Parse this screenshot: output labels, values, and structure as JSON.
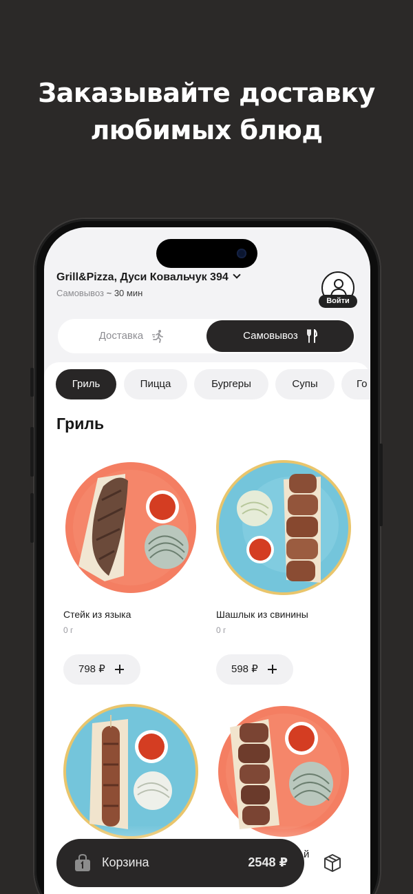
{
  "promo": {
    "headline_line1": "Заказывайте доставку",
    "headline_line2": "любимых блюд"
  },
  "header": {
    "store_name": "Grill&Pizza, Дуси Ковальчук 394",
    "mode_text": "Самовывоз",
    "time_text": "~ 30 мин",
    "login_label": "Войти"
  },
  "mode_toggle": {
    "delivery": "Доставка",
    "pickup": "Самовывоз",
    "selected": "pickup"
  },
  "categories": [
    "Гриль",
    "Пицца",
    "Бургеры",
    "Супы",
    "Го"
  ],
  "section": {
    "title": "Гриль"
  },
  "products": [
    {
      "name": "Стейк из языка",
      "weight": "0 г",
      "price": "798 ₽"
    },
    {
      "name": "Шашлык из свинины",
      "weight": "0 г",
      "price": "598 ₽"
    },
    {
      "name": "",
      "weight": "",
      "price": ""
    },
    {
      "name": "",
      "weight": "",
      "price": ""
    }
  ],
  "cart": {
    "label": "Корзина",
    "total": "2548 ₽",
    "peek_text": "й"
  },
  "colors": {
    "background": "#2b2928",
    "dark": "#282626",
    "chip": "#f1f1f3"
  },
  "icons": [
    "chevron-down-icon",
    "user-icon",
    "running-icon",
    "fork-knife-icon",
    "plus-icon",
    "bag-icon",
    "box-icon"
  ]
}
